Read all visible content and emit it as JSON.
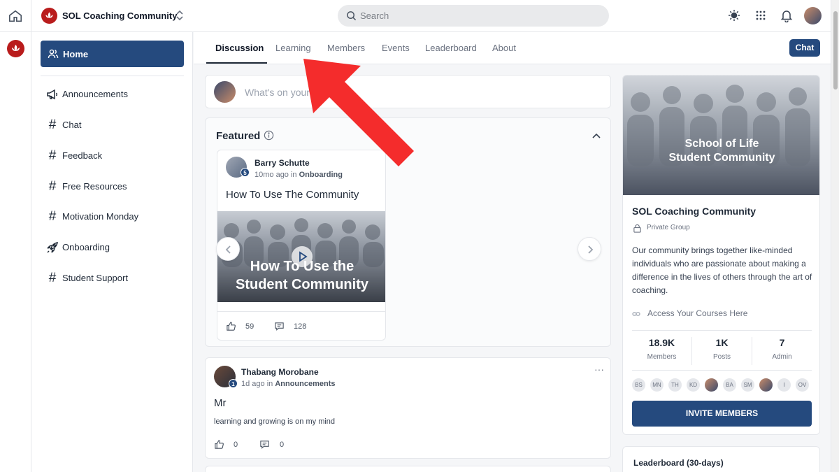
{
  "topbar": {
    "community_name": "SOL Coaching Community",
    "search_placeholder": "Search"
  },
  "sidebar": {
    "home_label": "Home",
    "items": [
      {
        "label": "Announcements",
        "icon": "megaphone-icon"
      },
      {
        "label": "Chat",
        "icon": "hash-icon"
      },
      {
        "label": "Feedback",
        "icon": "hash-icon"
      },
      {
        "label": "Free Resources",
        "icon": "hash-icon"
      },
      {
        "label": "Motivation Monday",
        "icon": "hash-icon"
      },
      {
        "label": "Onboarding",
        "icon": "rocket-icon"
      },
      {
        "label": "Student Support",
        "icon": "hash-icon"
      }
    ]
  },
  "tabs": [
    "Discussion",
    "Learning",
    "Members",
    "Events",
    "Leaderboard",
    "About"
  ],
  "chat_button": "Chat",
  "composer": {
    "placeholder": "What's on your mind?"
  },
  "featured": {
    "title": "Featured",
    "post": {
      "author": "Barry Schutte",
      "level": "5",
      "time": "10mo ago in ",
      "channel": "Onboarding",
      "title": "How To Use The Community",
      "thumb_line1": "How To Use the",
      "thumb_line2": "Student Community",
      "likes": "59",
      "comments": "128"
    }
  },
  "post": {
    "author": "Thabang Morobane",
    "level": "1",
    "time": "1d ago in ",
    "channel": "Announcements",
    "title": "Mr",
    "body": "learning and growing is on my mind",
    "likes": "0",
    "comments": "0"
  },
  "about": {
    "banner_line1": "School of Life",
    "banner_line2": "Student Community",
    "name": "SOL Coaching Community",
    "privacy": "Private Group",
    "description": "Our community brings together like-minded individuals who are passionate about making a difference in the lives of others through the art of coaching.",
    "link": "Access Your Courses Here",
    "stats": [
      {
        "value": "18.9K",
        "label": "Members"
      },
      {
        "value": "1K",
        "label": "Posts"
      },
      {
        "value": "7",
        "label": "Admin"
      }
    ],
    "members": [
      "BS",
      "MN",
      "TH",
      "KD",
      "",
      "BA",
      "SM",
      "",
      "I",
      "OV"
    ],
    "invite_label": "INVITE MEMBERS"
  },
  "leaderboard": {
    "title": "Leaderboard (30-days)"
  },
  "colors": {
    "primary": "#254a7e",
    "annotation_arrow": "#f42c2c"
  }
}
